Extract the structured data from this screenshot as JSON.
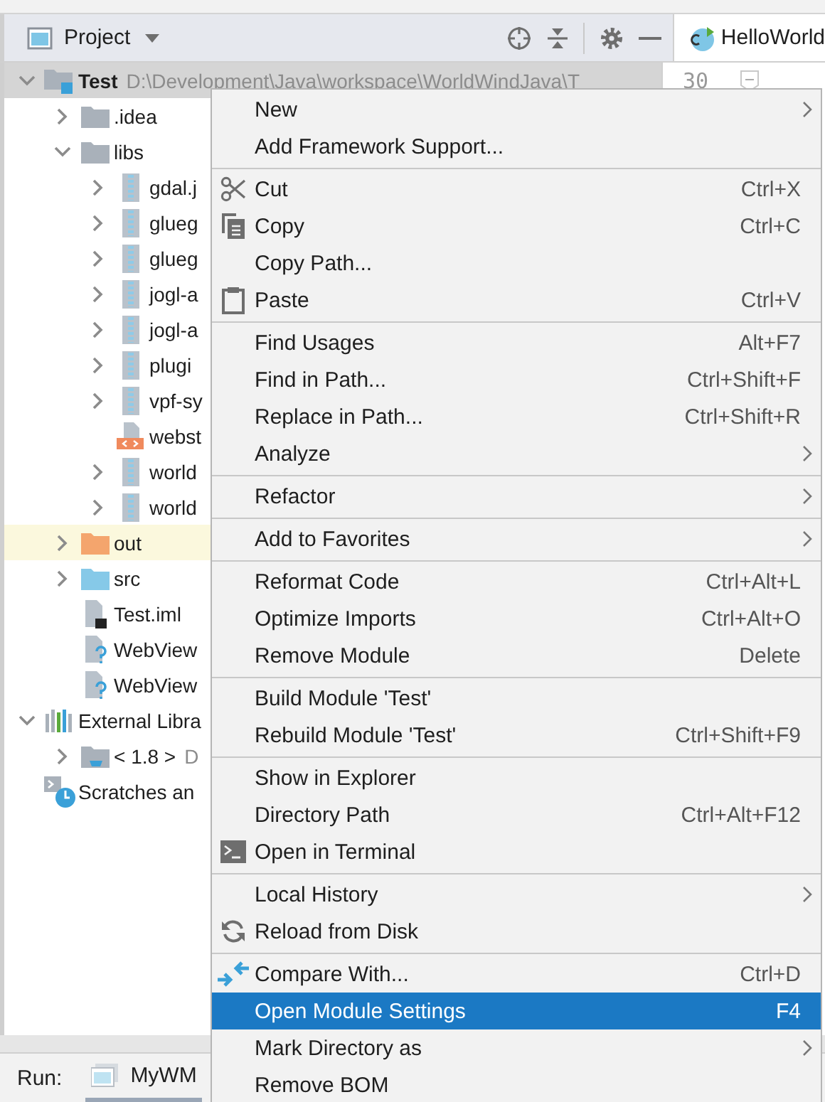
{
  "project_panel": {
    "title": "Project",
    "tree": [
      {
        "label": "Test",
        "detail": "D:\\Development\\Java\\workspace\\WorldWindJava\\T",
        "kind": "module",
        "expanded": true,
        "children": [
          {
            "label": ".idea",
            "kind": "folder",
            "expanded": false
          },
          {
            "label": "libs",
            "kind": "folder",
            "expanded": true,
            "children": [
              {
                "label": "gdal.j",
                "kind": "jar",
                "expanded": false
              },
              {
                "label": "glueg",
                "kind": "jar",
                "expanded": false
              },
              {
                "label": "glueg",
                "kind": "jar",
                "expanded": false
              },
              {
                "label": "jogl-a",
                "kind": "jar",
                "expanded": false
              },
              {
                "label": "jogl-a",
                "kind": "jar",
                "expanded": false
              },
              {
                "label": "plugi",
                "kind": "jar",
                "expanded": false
              },
              {
                "label": "vpf-sy",
                "kind": "jar",
                "expanded": false
              },
              {
                "label": "webst",
                "kind": "html"
              },
              {
                "label": "world",
                "kind": "jar",
                "expanded": false
              },
              {
                "label": "world",
                "kind": "jar",
                "expanded": false
              }
            ]
          },
          {
            "label": "out",
            "kind": "excluded-folder",
            "expanded": false,
            "highlighted": true
          },
          {
            "label": "src",
            "kind": "source-folder",
            "expanded": false
          },
          {
            "label": "Test.iml",
            "kind": "iml"
          },
          {
            "label": "WebView",
            "kind": "unknown-file"
          },
          {
            "label": "WebView",
            "kind": "unknown-file"
          }
        ]
      },
      {
        "label": "External Libra",
        "kind": "libraries",
        "expanded": true,
        "children": [
          {
            "label": "< 1.8 >",
            "detail": "D",
            "kind": "jdk",
            "expanded": false
          }
        ]
      },
      {
        "label": "Scratches an",
        "kind": "scratches"
      }
    ]
  },
  "editor": {
    "tab": "HelloWorld",
    "line_number": "30"
  },
  "run_bar": {
    "label": "Run:",
    "tab": "MyWM"
  },
  "context_menu": [
    [
      {
        "label": "New",
        "kind": "plain",
        "submenu": true,
        "selected": false
      },
      {
        "label": "Add Framework Support...",
        "kind": "plain",
        "submenu": false,
        "selected": false
      }
    ],
    [
      {
        "label": "Cut",
        "shortcut": "Ctrl+X",
        "kind": "cut",
        "submenu": false,
        "selected": false
      },
      {
        "label": "Copy",
        "shortcut": "Ctrl+C",
        "kind": "copy",
        "submenu": false,
        "selected": false
      },
      {
        "label": "Copy Path...",
        "kind": "plain",
        "submenu": false,
        "selected": false
      },
      {
        "label": "Paste",
        "shortcut": "Ctrl+V",
        "kind": "paste",
        "submenu": false,
        "selected": false
      }
    ],
    [
      {
        "label": "Find Usages",
        "shortcut": "Alt+F7",
        "kind": "plain",
        "submenu": false,
        "selected": false
      },
      {
        "label": "Find in Path...",
        "shortcut": "Ctrl+Shift+F",
        "kind": "plain",
        "submenu": false,
        "selected": false
      },
      {
        "label": "Replace in Path...",
        "shortcut": "Ctrl+Shift+R",
        "kind": "plain",
        "submenu": false,
        "selected": false
      },
      {
        "label": "Analyze",
        "kind": "plain",
        "submenu": true,
        "selected": false
      }
    ],
    [
      {
        "label": "Refactor",
        "kind": "plain",
        "submenu": true,
        "selected": false
      }
    ],
    [
      {
        "label": "Add to Favorites",
        "kind": "plain",
        "submenu": true,
        "selected": false
      }
    ],
    [
      {
        "label": "Reformat Code",
        "shortcut": "Ctrl+Alt+L",
        "kind": "plain",
        "submenu": false,
        "selected": false
      },
      {
        "label": "Optimize Imports",
        "shortcut": "Ctrl+Alt+O",
        "kind": "plain",
        "submenu": false,
        "selected": false
      },
      {
        "label": "Remove Module",
        "shortcut": "Delete",
        "kind": "plain",
        "submenu": false,
        "selected": false
      }
    ],
    [
      {
        "label": "Build Module 'Test'",
        "kind": "plain",
        "submenu": false,
        "selected": false
      },
      {
        "label": "Rebuild Module 'Test'",
        "shortcut": "Ctrl+Shift+F9",
        "kind": "plain",
        "submenu": false,
        "selected": false
      }
    ],
    [
      {
        "label": "Show in Explorer",
        "kind": "plain",
        "submenu": false,
        "selected": false
      },
      {
        "label": "Directory Path",
        "shortcut": "Ctrl+Alt+F12",
        "kind": "plain",
        "submenu": false,
        "selected": false
      },
      {
        "label": "Open in Terminal",
        "kind": "terminal",
        "submenu": false,
        "selected": false
      }
    ],
    [
      {
        "label": "Local History",
        "kind": "plain",
        "submenu": true,
        "selected": false
      },
      {
        "label": "Reload from Disk",
        "kind": "reload",
        "submenu": false,
        "selected": false
      }
    ],
    [
      {
        "label": "Compare With...",
        "shortcut": "Ctrl+D",
        "kind": "compare",
        "submenu": false,
        "selected": false
      },
      {
        "label": "Open Module Settings",
        "shortcut": "F4",
        "kind": "plain",
        "submenu": false,
        "selected": true
      },
      {
        "label": "Mark Directory as",
        "kind": "plain",
        "submenu": true,
        "selected": false
      },
      {
        "label": "Remove BOM",
        "kind": "plain",
        "submenu": false,
        "selected": false
      }
    ]
  ]
}
